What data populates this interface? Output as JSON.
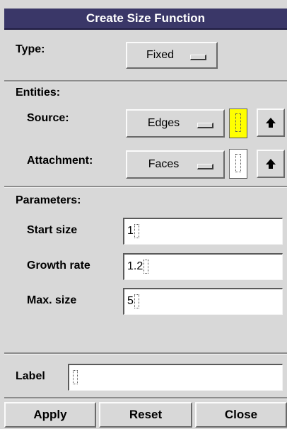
{
  "window": {
    "title": "Create Size Function"
  },
  "type": {
    "label": "Type:",
    "value": "Fixed"
  },
  "entities": {
    "heading": "Entities:",
    "source": {
      "label": "Source:",
      "value": "Edges",
      "pick_color": "#ffff00"
    },
    "attachment": {
      "label": "Attachment:",
      "value": "Faces"
    }
  },
  "parameters": {
    "heading": "Parameters:",
    "start_size": {
      "label": "Start size",
      "value": "1"
    },
    "growth_rate": {
      "label": "Growth rate",
      "value": "1.2"
    },
    "max_size": {
      "label": "Max. size",
      "value": "5"
    }
  },
  "label_field": {
    "label": "Label",
    "value": ""
  },
  "buttons": {
    "apply": "Apply",
    "reset": "Reset",
    "close": "Close"
  },
  "icons": {
    "arrow": "up-arrow-icon"
  }
}
